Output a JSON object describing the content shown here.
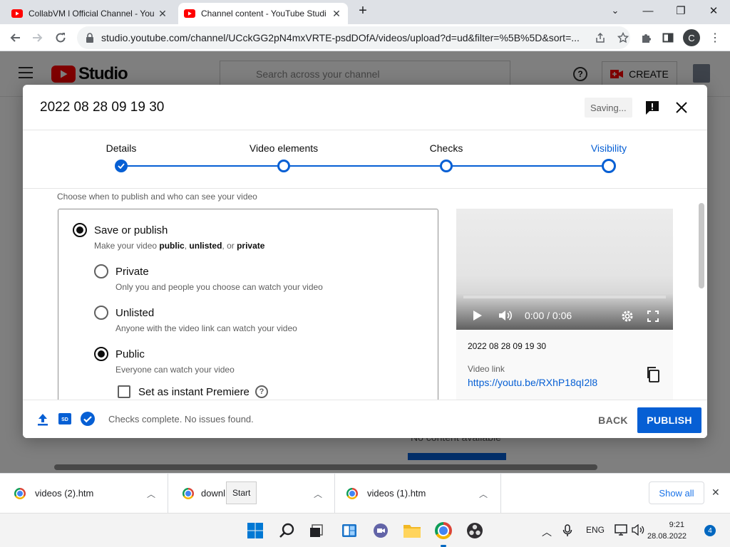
{
  "browser": {
    "tabs": [
      {
        "title": "CollabVM l Official Channel - You",
        "active": false
      },
      {
        "title": "Channel content - YouTube Studi",
        "active": true
      }
    ],
    "new_tab": "+",
    "window_controls": {
      "minimize": "—",
      "restore": "❐",
      "close": "✕"
    },
    "url": "studio.youtube.com/channel/UCckGG2pN4mxVRTE-psdDOfA/videos/upload?d=ud&filter=%5B%5D&sort=...",
    "profile_initial": "C"
  },
  "studio": {
    "logo_text": "Studio",
    "search_placeholder": "Search across your channel",
    "create_label": "CREATE",
    "background_text": "No content available"
  },
  "dialog": {
    "title": "2022 08 28 09 19 30",
    "saving_label": "Saving...",
    "steps": [
      {
        "label": "Details",
        "state": "done"
      },
      {
        "label": "Video elements",
        "state": "pending"
      },
      {
        "label": "Checks",
        "state": "pending"
      },
      {
        "label": "Visibility",
        "state": "current"
      }
    ],
    "subtitle": "Choose when to publish and who can see your video",
    "save_or_publish": {
      "label": "Save or publish",
      "desc_prefix": "Make your video ",
      "desc_public": "public",
      "desc_sep1": ", ",
      "desc_unlisted": "unlisted",
      "desc_sep2": ", or ",
      "desc_private": "private",
      "selected": true
    },
    "options": [
      {
        "label": "Private",
        "desc": "Only you and people you choose can watch your video",
        "selected": false
      },
      {
        "label": "Unlisted",
        "desc": "Anyone with the video link can watch your video",
        "selected": false
      },
      {
        "label": "Public",
        "desc": "Everyone can watch your video",
        "selected": true
      }
    ],
    "premiere_label": "Set as instant Premiere",
    "premiere_checked": false,
    "help_glyph": "?",
    "preview": {
      "time": "0:00 / 0:06",
      "video_name": "2022 08 28 09 19 30",
      "link_label": "Video link",
      "link": "https://youtu.be/RXhP18qI2l8"
    },
    "footer": {
      "status": "Checks complete. No issues found.",
      "back_label": "BACK",
      "publish_label": "PUBLISH"
    }
  },
  "downloads": {
    "items": [
      {
        "name": "videos (2).htm"
      },
      {
        "name": "downl"
      },
      {
        "name": "videos (1).htm"
      }
    ],
    "tooltip": "Start",
    "show_all": "Show all",
    "close": "✕"
  },
  "taskbar": {
    "language": "ENG",
    "time": "9:21",
    "date": "28.08.2022",
    "notifications": "4",
    "accent": "#0067c0"
  },
  "colors": {
    "youtube_red": "#ff0000",
    "link_blue": "#065fd4"
  }
}
